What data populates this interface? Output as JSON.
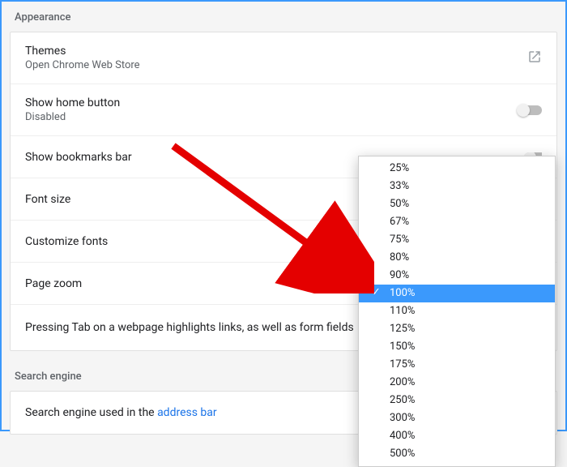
{
  "appearance": {
    "header": "Appearance",
    "themes": {
      "title": "Themes",
      "sub": "Open Chrome Web Store"
    },
    "home_button": {
      "title": "Show home button",
      "sub": "Disabled"
    },
    "bookmarks": {
      "title": "Show bookmarks bar"
    },
    "font_size": {
      "title": "Font size"
    },
    "customize_fonts": {
      "title": "Customize fonts"
    },
    "page_zoom": {
      "title": "Page zoom"
    },
    "tab_highlight": {
      "title": "Pressing Tab on a webpage highlights links, as well as form fields"
    }
  },
  "search_engine": {
    "header": "Search engine",
    "row_prefix": "Search engine used in the ",
    "row_link": "address bar"
  },
  "zoom_options": [
    "25%",
    "33%",
    "50%",
    "67%",
    "75%",
    "80%",
    "90%",
    "100%",
    "110%",
    "125%",
    "150%",
    "175%",
    "200%",
    "250%",
    "300%",
    "400%",
    "500%"
  ],
  "zoom_selected": "100%"
}
